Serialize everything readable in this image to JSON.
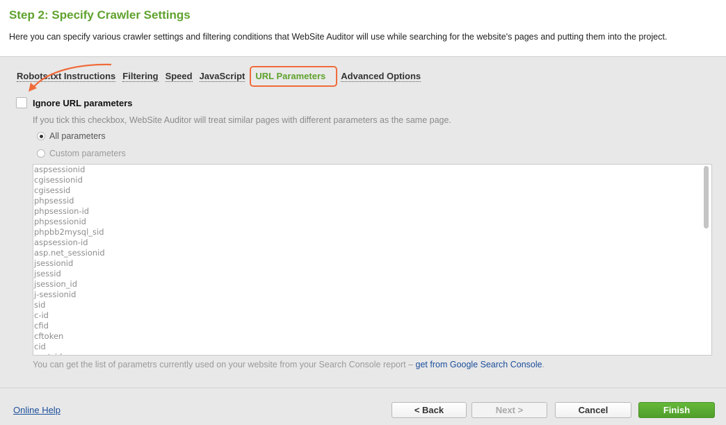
{
  "header": {
    "title": "Step 2: Specify Crawler Settings",
    "description": "Here you can specify various crawler settings and filtering conditions that WebSite Auditor will use while searching for the website's pages and putting them into the project."
  },
  "tabs": [
    {
      "label": "Robots.txt Instructions",
      "active": false
    },
    {
      "label": "Filtering",
      "active": false
    },
    {
      "label": "Speed",
      "active": false
    },
    {
      "label": "JavaScript",
      "active": false
    },
    {
      "label": "URL Parameters",
      "active": true
    },
    {
      "label": "Advanced Options",
      "active": false
    }
  ],
  "ignore_params": {
    "label": "Ignore URL parameters",
    "checked": false,
    "hint": "If you tick this checkbox, WebSite Auditor will treat similar pages with different parameters as the same page."
  },
  "radio": {
    "all_label": "All parameters",
    "custom_label": "Custom parameters",
    "selected": "all"
  },
  "params": [
    "aspsessionid",
    "cgisessionid",
    "cgisessid",
    "phpsessid",
    "phpsession-id",
    "phpsessionid",
    "phpbb2mysql_sid",
    "aspsession-id",
    "asp.net_sessionid",
    "jsessionid",
    "jsessid",
    "jsession_id",
    "j-sessionid",
    "sid",
    "c-id",
    "cfid",
    "cftoken",
    "cid",
    "cust_id"
  ],
  "footer_note": {
    "text": "You can get the list of parametrs currently used on your website from your Search Console report –",
    "link": "get from Google Search Console",
    "suffix": "."
  },
  "buttons": {
    "help": "Online Help",
    "back": "< Back",
    "next": "Next >",
    "cancel": "Cancel",
    "finish": "Finish"
  },
  "colors": {
    "accent_green": "#5fa22d",
    "highlight_orange": "#f06b3a",
    "link_blue": "#1b4e9b"
  }
}
